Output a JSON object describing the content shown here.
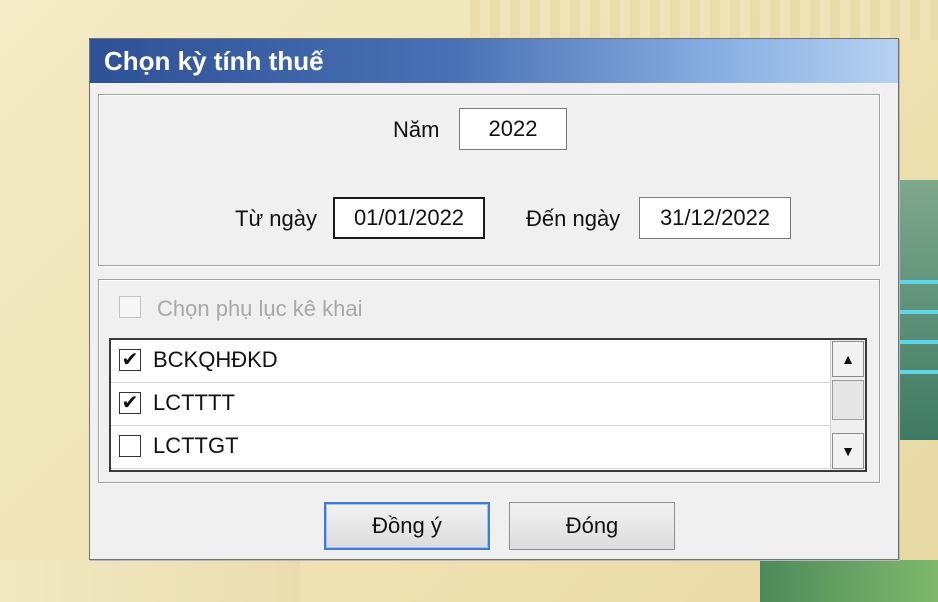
{
  "dialog": {
    "title": "Chọn kỳ tính thuế",
    "year_label": "Năm",
    "year_value": "2022",
    "from_label": "Từ ngày",
    "from_value": "01/01/2022",
    "to_label": "Đến ngày",
    "to_value": "31/12/2022",
    "appendix_checkbox_label": "Chọn phụ lục kê khai",
    "appendix_checked": false,
    "appendix_items": [
      {
        "label": "BCKQHĐKD",
        "checked": true
      },
      {
        "label": "LCTTTT",
        "checked": true
      },
      {
        "label": "LCTTGT",
        "checked": false
      }
    ],
    "ok_button": "Đồng ý",
    "close_button": "Đóng"
  },
  "colors": {
    "title_gradient_start": "#2f5196",
    "title_gradient_end": "#b7d1f1",
    "default_button_border": "#3d7bd6"
  },
  "icons": {
    "scroll_up": "scroll-up-arrow-icon",
    "scroll_down": "scroll-down-arrow-icon",
    "check": "checkmark-icon"
  }
}
